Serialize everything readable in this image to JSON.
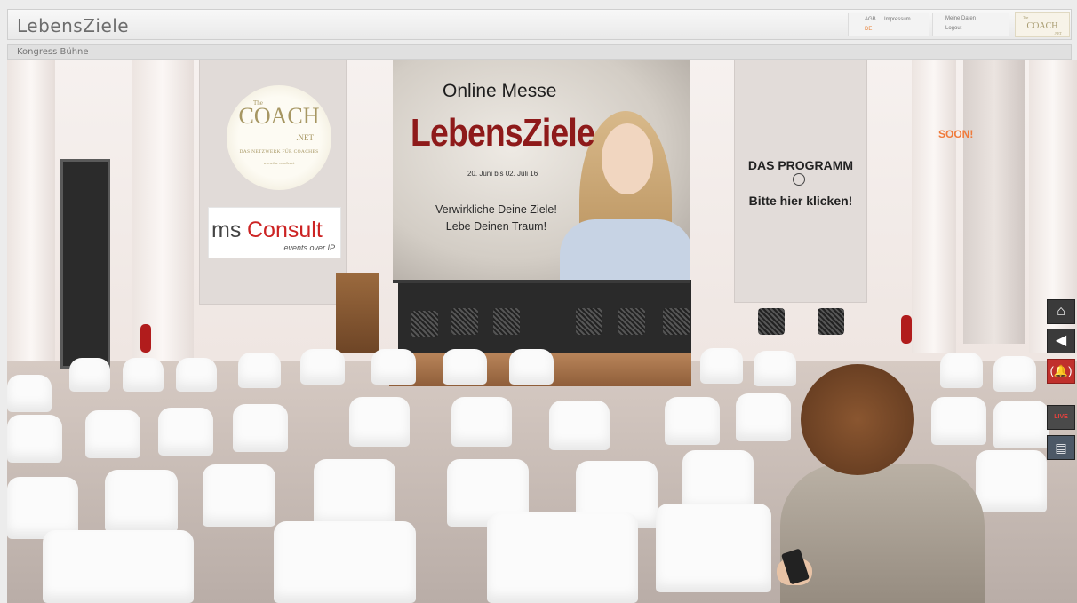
{
  "header": {
    "logo": "LebensZiele",
    "links": {
      "agb": "AGB",
      "impressum": "Impressum",
      "language": "DE"
    },
    "account": {
      "meine_daten": "Meine Daten",
      "logout": "Logout"
    },
    "partner_logo": {
      "the": "The",
      "word": "COACH",
      "net": ".NET"
    }
  },
  "subbar": {
    "title": "Kongress Bühne"
  },
  "scene": {
    "coach_banner": {
      "the": "The",
      "word": "COACH",
      "net": ".NET",
      "tagline": "DAS NETZWERK FÜR COACHES",
      "url": "www.the-coach.net"
    },
    "msconsult": {
      "ms": "ms",
      "consult": "Consult",
      "subtitle": "events over IP"
    },
    "screen": {
      "heading": "Online Messe",
      "title": "LebensZiele",
      "dates": "20. Juni bis 02. Juli 16",
      "slogan1": "Verwirkliche Deine Ziele!",
      "slogan2": "Lebe Deinen Traum!"
    },
    "program": {
      "title": "DAS PROGRAMM",
      "cta": "Bitte hier klicken!"
    },
    "soon": "SOON!"
  },
  "side_buttons": {
    "live_label": "LIVE",
    "icons": [
      "home-icon",
      "back-arrow-icon",
      "alarm-bell-icon",
      "live-icon",
      "book-icon"
    ]
  },
  "colors": {
    "accent_orange": "#f07a3a",
    "brand_red": "#8e1a1a",
    "msconsult_red": "#cc2323",
    "alert_red": "#c0302c"
  }
}
